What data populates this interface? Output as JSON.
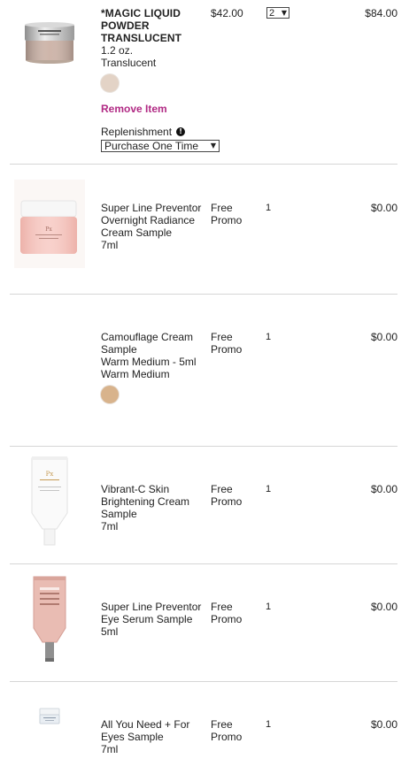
{
  "items": [
    {
      "name": "*MAGIC LIQUID POWDER TRANSLUCENT",
      "size": "1.2 oz.",
      "shade": "Translucent",
      "swatch_color": "#e3d3c6",
      "price": "$42.00",
      "qty": "2",
      "total": "$84.00",
      "remove_label": "Remove Item",
      "replenishment_label": "Replenishment",
      "replenishment_value": "Purchase One Time"
    },
    {
      "name": "Super Line Preventor Overnight Radiance Cream Sample",
      "size": "7ml",
      "price_line1": "Free",
      "price_line2": "Promo",
      "qty": "1",
      "total": "$0.00"
    },
    {
      "name": "Camouflage Cream Sample",
      "size": "Warm Medium - 5ml",
      "shade": "Warm Medium",
      "swatch_color": "#d8b38c",
      "price_line1": "Free",
      "price_line2": "Promo",
      "qty": "1",
      "total": "$0.00"
    },
    {
      "name": "Vibrant-C Skin Brightening Cream Sample",
      "size": "7ml",
      "price_line1": "Free",
      "price_line2": "Promo",
      "qty": "1",
      "total": "$0.00"
    },
    {
      "name": "Super Line Preventor Eye Serum Sample",
      "size": "5ml",
      "price_line1": "Free",
      "price_line2": "Promo",
      "qty": "1",
      "total": "$0.00"
    },
    {
      "name": "All You Need + For Eyes Sample",
      "size": "7ml",
      "price_line1": "Free",
      "price_line2": "Promo",
      "qty": "1",
      "total": "$0.00"
    }
  ],
  "icons": {
    "info": "info-icon",
    "dropdown": "caret-down-icon"
  },
  "colors": {
    "remove_link": "#b12a84",
    "divider": "#d6d6d6"
  }
}
